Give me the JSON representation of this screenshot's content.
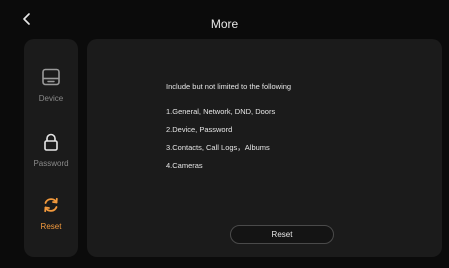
{
  "header": {
    "title": "More",
    "back_icon": "chevron-left-icon"
  },
  "sidebar": {
    "items": [
      {
        "label": "Device",
        "icon": "device-icon",
        "active": false
      },
      {
        "label": "Password",
        "icon": "lock-icon",
        "active": false
      },
      {
        "label": "Reset",
        "icon": "refresh-icon",
        "active": true
      }
    ]
  },
  "main": {
    "intro": "Include but not limited to the following",
    "items": [
      "1.General, Network, DND, Doors",
      "2.Device, Password",
      "3.Contacts, Call Logs，Albums",
      "4.Cameras"
    ],
    "reset_label": "Reset"
  },
  "colors": {
    "accent": "#f39a3d",
    "panel": "#1b1b1b",
    "background": "#0b0b0b"
  }
}
